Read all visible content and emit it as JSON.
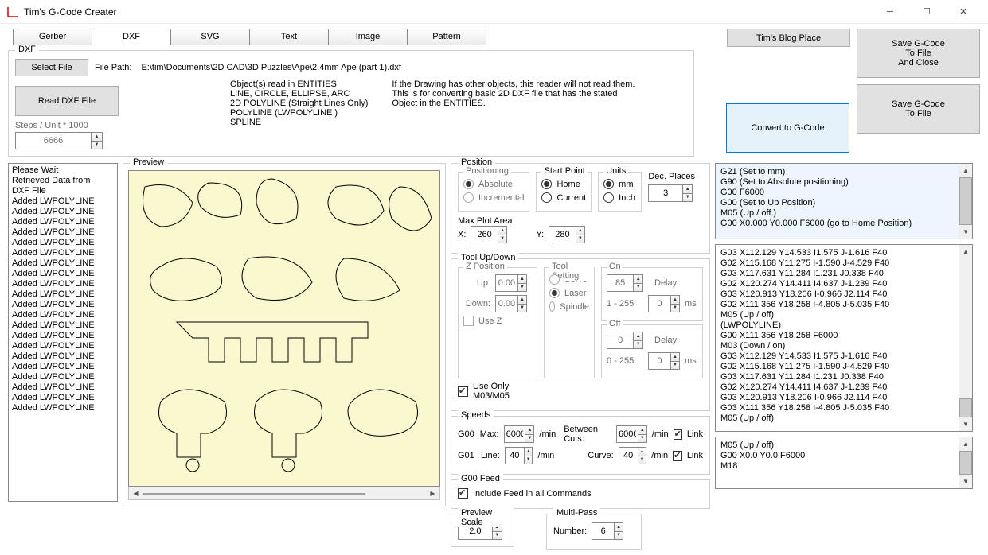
{
  "window": {
    "title": "Tim's G-Code Creater"
  },
  "tabs": {
    "gerber": "Gerber",
    "dxf": "DXF",
    "svg": "SVG",
    "text": "Text",
    "image": "Image",
    "pattern": "Pattern"
  },
  "buttons": {
    "blog": "Tim's Blog Place",
    "save_close": "Save G-Code\nTo File\nAnd Close",
    "save": "Save G-Code\nTo File",
    "convert": "Convert to G-Code",
    "select_file": "Select File",
    "read_dxf": "Read DXF File"
  },
  "dxf": {
    "legend": "DXF",
    "filepath_label": "File Path:",
    "filepath": "E:\\tim\\Documents\\2D CAD\\3D Puzzles\\Ape\\2.4mm Ape (part 1).dxf",
    "steps_label": "Steps / Unit * 1000",
    "steps_value": "6666",
    "objects_heading": "Object(s) read in ENTITIES",
    "objects_list": "LINE, CIRCLE, ELLIPSE, ARC\n2D POLYLINE (Straight Lines Only)\nPOLYLINE (LWPOLYLINE )\nSPLINE",
    "note": "If the Drawing has other objects, this reader will not read them.\nThis is for converting basic 2D DXF file that has the stated\nObject in the ENTITIES."
  },
  "log_lines": [
    "Please Wait",
    "Retrieved Data from",
    "DXF File",
    "Added LWPOLYLINE",
    "Added LWPOLYLINE",
    "Added LWPOLYLINE",
    "Added LWPOLYLINE",
    "Added LWPOLYLINE",
    "Added LWPOLYLINE",
    "Added LWPOLYLINE",
    "Added LWPOLYLINE",
    "Added LWPOLYLINE",
    "Added LWPOLYLINE",
    "Added LWPOLYLINE",
    "Added LWPOLYLINE",
    "Added LWPOLYLINE",
    "Added LWPOLYLINE",
    "Added LWPOLYLINE",
    "Added LWPOLYLINE",
    "Added LWPOLYLINE",
    "Added LWPOLYLINE",
    "Added LWPOLYLINE",
    "Added LWPOLYLINE",
    "Added LWPOLYLINE"
  ],
  "preview_legend": "Preview",
  "position": {
    "legend": "Position",
    "positioning_legend": "Positioning",
    "absolute": "Absolute",
    "incremental": "Incremental",
    "start_legend": "Start Point",
    "home": "Home",
    "current": "Current",
    "units_legend": "Units",
    "mm": "mm",
    "inch": "Inch",
    "dec_label": "Dec. Places",
    "dec_value": "3",
    "max_label": "Max Plot Area",
    "x_label": "X:",
    "x_value": "260",
    "y_label": "Y:",
    "y_value": "280"
  },
  "tool": {
    "legend": "Tool Up/Down",
    "zpos_legend": "Z Position",
    "up": "Up:",
    "up_v": "0.00",
    "down": "Down:",
    "down_v": "0.00",
    "usez": "Use Z",
    "setting_legend": "Tool Setting",
    "servo": "Servo",
    "laser": "Laser",
    "spindle": "Spindle",
    "on_legend": "On",
    "on_v": "85",
    "on_range": "1 - 255",
    "off_legend": "Off",
    "off_v": "0",
    "off_range": "0 - 255",
    "delay": "Delay:",
    "delay_v": "0",
    "ms": "ms",
    "useonly": "Use Only\nM03/M05"
  },
  "speeds": {
    "legend": "Speeds",
    "g00": "G00",
    "max": "Max:",
    "max_v": "6000",
    "permin": "/min",
    "between": "Between Cuts:",
    "between_v": "6000",
    "link": "Link",
    "g01": "G01",
    "line": "Line:",
    "line_v": "40",
    "curve": "Curve:",
    "curve_v": "40"
  },
  "g00feed": {
    "legend": "G00 Feed",
    "include": "Include Feed in all Commands"
  },
  "preview_scale": {
    "legend": "Preview Scale",
    "value": "2.0"
  },
  "multipass": {
    "legend": "Multi-Pass",
    "number": "Number:",
    "value": "6"
  },
  "gcode1": [
    "G21 (Set to mm)",
    "G90 (Set to Absolute positioning)",
    "G00 F6000",
    "G00 (Set to Up Position)",
    "M05   (Up / off.)",
    "G00 X0.000 Y0.000  F6000 (go to Home Position)"
  ],
  "gcode2": [
    "G03 X112.129 Y14.533 I1.575 J-1.616 F40",
    "G02 X115.168 Y11.275 I-1.590 J-4.529 F40",
    "G03 X117.631 Y11.284 I1.231 J0.338 F40",
    "G02 X120.274 Y14.411 I4.637 J-1.239 F40",
    "G03 X120.913 Y18.206 I-0.966 J2.114 F40",
    "G02 X111.356 Y18.258 I-4.805 J-5.035 F40",
    "M05 (Up / off)",
    "(LWPOLYLINE)",
    "G00 X111.356 Y18.258 F6000",
    "M03 (Down / on)",
    "G03 X112.129 Y14.533 I1.575 J-1.616 F40",
    "G02 X115.168 Y11.275 I-1.590 J-4.529 F40",
    "G03 X117.631 Y11.284 I1.231 J0.338 F40",
    "G02 X120.274 Y14.411 I4.637 J-1.239 F40",
    "G03 X120.913 Y18.206 I-0.966 J2.114 F40",
    "G03 X111.356 Y18.258 I-4.805 J-5.035 F40",
    "M05 (Up / off)"
  ],
  "gcode3": [
    "M05 (Up / off)",
    "G00 X0.0 Y0.0 F6000",
    "M18"
  ]
}
